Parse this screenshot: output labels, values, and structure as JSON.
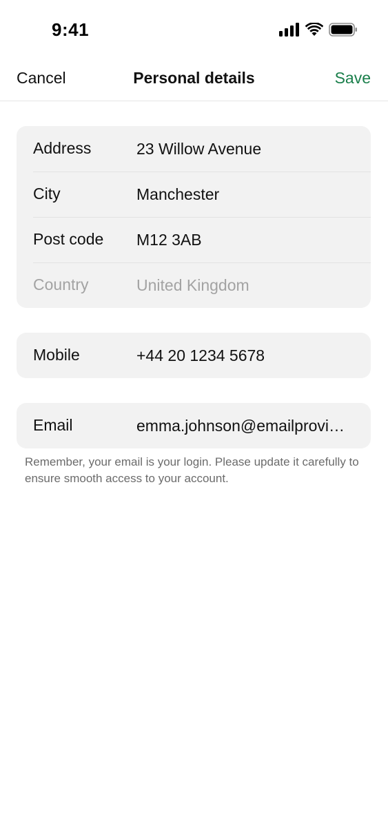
{
  "status_bar": {
    "time": "9:41"
  },
  "nav": {
    "cancel_label": "Cancel",
    "title": "Personal details",
    "save_label": "Save"
  },
  "address_card": {
    "rows": [
      {
        "label": "Address",
        "value": "23  Willow Avenue",
        "disabled": false
      },
      {
        "label": "City",
        "value": "Manchester",
        "disabled": false
      },
      {
        "label": "Post code",
        "value": "M12 3AB",
        "disabled": false
      },
      {
        "label": "Country",
        "value": "United Kingdom",
        "disabled": true
      }
    ]
  },
  "mobile_card": {
    "label": "Mobile",
    "value": "+44 20 1234 5678"
  },
  "email_card": {
    "label": "Email",
    "value": "emma.johnson@emailprovider.com",
    "helper": "Remember, your email is your login. Please update it carefully to ensure smooth access to your account."
  },
  "colors": {
    "accent": "#1a7f4b",
    "card_bg": "#f2f2f2",
    "disabled_text": "#a3a3a3",
    "helper_text": "#6b6b6b"
  },
  "icons": [
    "cellular-signal-icon",
    "wifi-icon",
    "battery-icon"
  ]
}
